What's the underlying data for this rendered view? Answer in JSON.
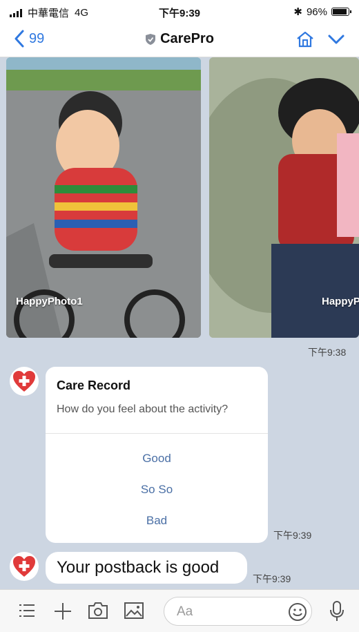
{
  "status_bar": {
    "carrier": "中華電信",
    "network": "4G",
    "time": "下午9:39",
    "battery": "96%",
    "battery_level": 0.96
  },
  "nav": {
    "back_count": "99",
    "title": "CarePro",
    "icons": [
      "chevron-left-icon",
      "shield-icon",
      "home-icon",
      "chevron-down-icon"
    ]
  },
  "photos": [
    {
      "label": "HappyPhoto1"
    },
    {
      "label": "HappyP"
    }
  ],
  "photo_timestamp": "下午9:38",
  "card": {
    "title": "Care Record",
    "subtitle": "How do you feel about the activity?",
    "actions": [
      "Good",
      "So So",
      "Bad"
    ],
    "timestamp": "下午9:39"
  },
  "message": {
    "text": "Your postback is good",
    "timestamp": "下午9:39"
  },
  "input_bar": {
    "placeholder": "Aa"
  },
  "colors": {
    "accent": "#2f78e0",
    "chat_bg": "#cdd6e2",
    "action_text": "#4a6fa5",
    "avatar_red": "#e03a3a"
  }
}
